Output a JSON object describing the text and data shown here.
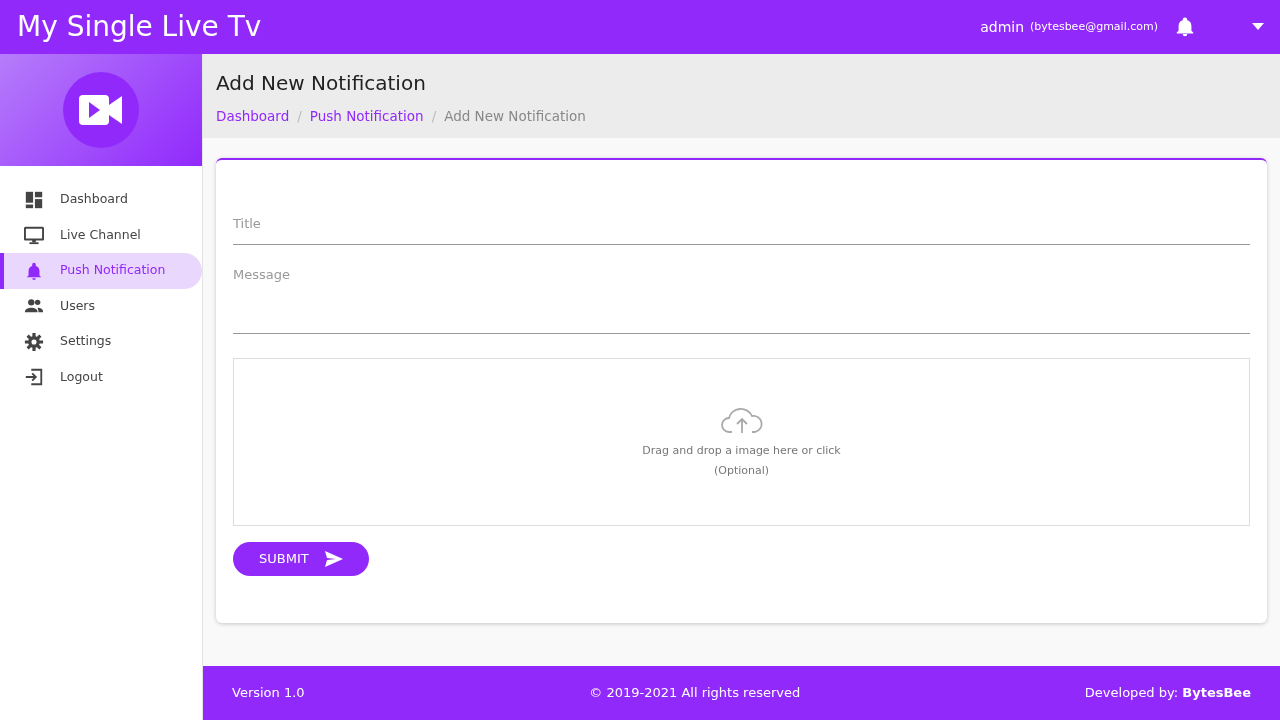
{
  "topbar": {
    "brand": "My Single Live Tv",
    "user_name": "admin",
    "user_email": "(bytesbee@gmail.com)"
  },
  "sidebar": {
    "items": [
      {
        "label": "Dashboard",
        "selected": false
      },
      {
        "label": "Live Channel",
        "selected": false
      },
      {
        "label": "Push Notification",
        "selected": true
      },
      {
        "label": "Users",
        "selected": false
      },
      {
        "label": "Settings",
        "selected": false
      },
      {
        "label": "Logout",
        "selected": false
      }
    ]
  },
  "page": {
    "title": "Add New Notification",
    "breadcrumb_separators": [
      "/",
      "/"
    ],
    "breadcrumb": [
      {
        "label": "Dashboard",
        "link": true
      },
      {
        "label": "Push Notification",
        "link": true
      },
      {
        "label": "Add New Notification",
        "link": false
      }
    ]
  },
  "form": {
    "fields": [
      {
        "placeholder": "Title",
        "kind": "input"
      },
      {
        "placeholder": "Message",
        "kind": "textarea"
      }
    ],
    "upload": {
      "text": "Drag and drop a image here or click",
      "note": "(Optional)"
    },
    "submit": "SUBMIT"
  },
  "footer": {
    "version": "Version 1.0",
    "copyright": "© 2019-2021 All rights reserved",
    "developer": "Developed by: **BytesBee**"
  }
}
